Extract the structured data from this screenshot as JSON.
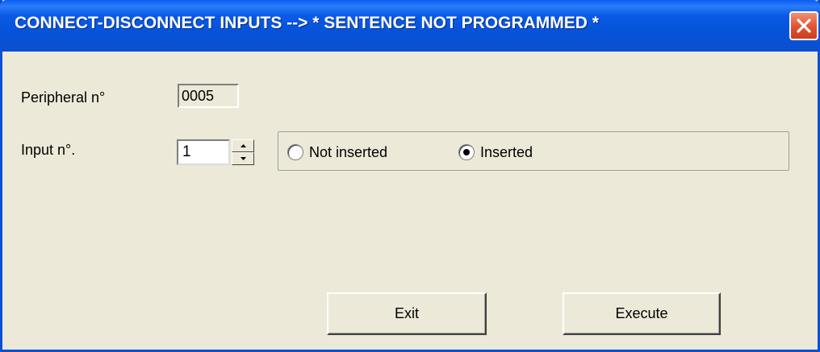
{
  "window": {
    "title": "CONNECT-DISCONNECT INPUTS --> * SENTENCE NOT PROGRAMMED *",
    "close_icon": "close-icon"
  },
  "form": {
    "peripheral_label": "Peripheral n°",
    "peripheral_value": "0005",
    "input_label": "Input n°.",
    "input_value": "1",
    "state_options": [
      {
        "label": "Not inserted",
        "checked": false
      },
      {
        "label": "Inserted",
        "checked": true
      }
    ]
  },
  "buttons": {
    "exit_label": "Exit",
    "execute_label": "Execute"
  },
  "colors": {
    "titlebar": "#0a5ae6",
    "face": "#ece9d8",
    "close": "#e0532e"
  }
}
